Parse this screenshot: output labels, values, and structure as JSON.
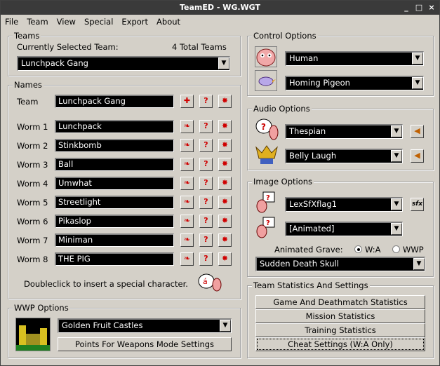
{
  "window": {
    "title": "TeamED - WG.WGT",
    "controls": [
      "_",
      "□",
      "×"
    ]
  },
  "menu": [
    "File",
    "Team",
    "View",
    "Special",
    "Export",
    "About"
  ],
  "teams": {
    "group_title": "Teams",
    "selected_label": "Currently Selected Team:",
    "total_label": "4 Total Teams",
    "selected_value": "Lunchpack Gang"
  },
  "names": {
    "group_title": "Names",
    "team_label": "Team",
    "team_value": "Lunchpack Gang",
    "worms": [
      {
        "label": "Worm 1",
        "value": "Lunchpack"
      },
      {
        "label": "Worm 2",
        "value": "Stinkbomb"
      },
      {
        "label": "Worm 3",
        "value": "Ball"
      },
      {
        "label": "Worm 4",
        "value": "Umwhat"
      },
      {
        "label": "Worm 5",
        "value": "Streetlight"
      },
      {
        "label": "Worm 6",
        "value": "Pikaslop"
      },
      {
        "label": "Worm 7",
        "value": "Miniman"
      },
      {
        "label": "Worm 8",
        "value": "THE PIG"
      }
    ],
    "hint": "Doubleclick to insert a special character."
  },
  "wwp": {
    "group_title": "WWP Options",
    "fort_value": "Golden Fruit Castles",
    "points_button": "Points For Weapons Mode Settings"
  },
  "control": {
    "group_title": "Control Options",
    "player_value": "Human",
    "weapon_value": "Homing Pigeon"
  },
  "audio": {
    "group_title": "Audio Options",
    "voice_value": "Thespian",
    "victory_value": "Belly Laugh"
  },
  "image": {
    "group_title": "Image Options",
    "flag_value": "LexSfXflag1",
    "grave_value": "[Animated]",
    "animated_grave_label": "Animated Grave:",
    "radio_wa": "W:A",
    "radio_wwp": "WWP",
    "fanfare_value": "Sudden Death Skull"
  },
  "stats": {
    "group_title": "Team Statistics And Settings",
    "buttons": [
      "Game And Deathmatch Statistics",
      "Mission Statistics",
      "Training Statistics",
      "Cheat Settings (W:A Only)"
    ]
  }
}
